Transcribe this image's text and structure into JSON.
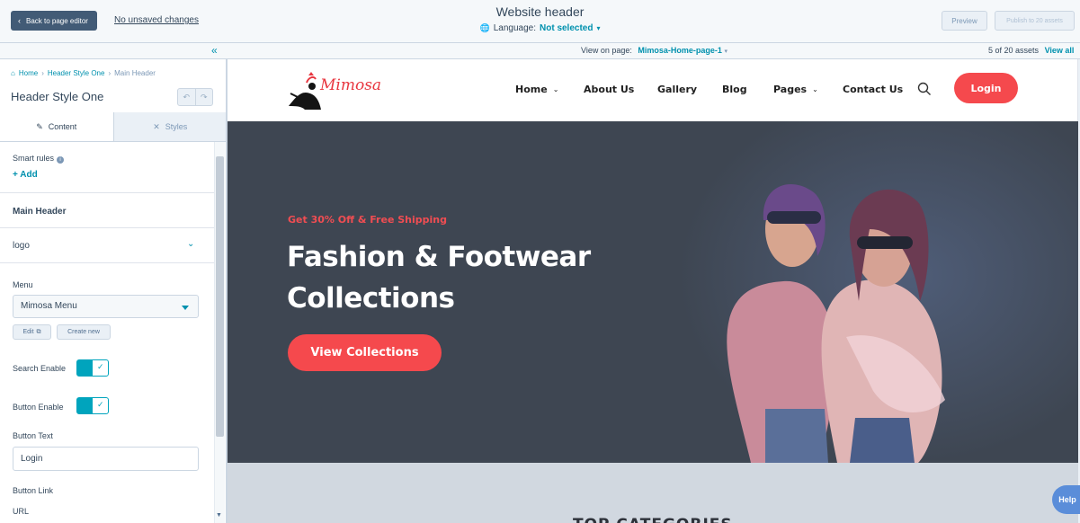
{
  "topbar": {
    "back_label": "Back to page editor",
    "unsaved_label": "No unsaved changes",
    "title": "Website header",
    "language_label": "Language:",
    "language_value": "Not selected",
    "preview_label": "Preview",
    "publish_label": "Publish to 20 assets"
  },
  "subbar": {
    "view_on_label": "View on page:",
    "view_on_value": "Mimosa-Home-page-1",
    "assets_count": "5 of 20 assets",
    "view_all_label": "View all"
  },
  "sidebar": {
    "breadcrumb": [
      "Home",
      "Header Style One",
      "Main Header"
    ],
    "module_title": "Header Style One",
    "tabs": [
      {
        "label": "Content",
        "icon": "pencil-icon"
      },
      {
        "label": "Styles",
        "icon": "styles-icon"
      }
    ],
    "smart_rules_label": "Smart rules",
    "add_label": "Add",
    "main_header_label": "Main Header",
    "logo_label": "logo",
    "menu_label": "Menu",
    "menu_value": "Mimosa Menu",
    "edit_label": "Edit",
    "create_new_label": "Create new",
    "search_enable_label": "Search Enable",
    "search_enabled": true,
    "button_enable_label": "Button Enable",
    "button_enabled": true,
    "button_text_label": "Button Text",
    "button_text_value": "Login",
    "button_link_label": "Button Link",
    "url_label": "URL"
  },
  "site": {
    "logo_text": "Mimosa",
    "nav": [
      "Home",
      "About Us",
      "Gallery",
      "Blog",
      "Pages",
      "Contact Us"
    ],
    "login_label": "Login",
    "promo": "Get 30% Off & Free Shipping",
    "hero_line1": "Fashion & Footwear",
    "hero_line2": "Collections",
    "cta_label": "View Collections",
    "categories_heading": "TOP CATEGORIES"
  },
  "help_label": "Help",
  "colors": {
    "brand_red": "#f5494d",
    "hubspot_teal": "#00a4bd",
    "hero_bg": "#3e4652"
  }
}
